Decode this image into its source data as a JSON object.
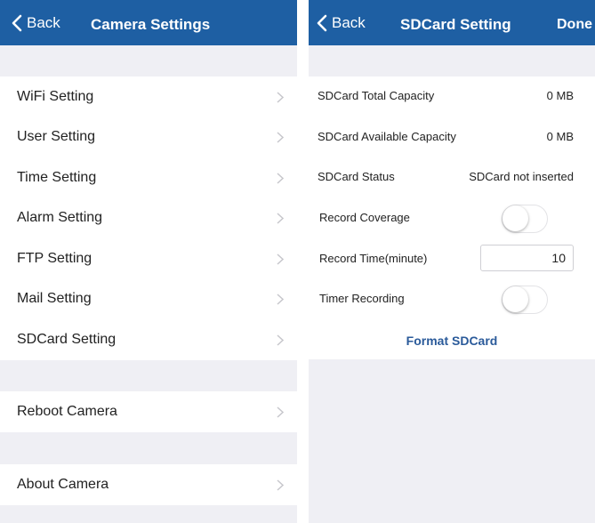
{
  "left": {
    "nav": {
      "back_label": "Back",
      "title": "Camera Settings"
    },
    "items": [
      {
        "label": "WiFi Setting"
      },
      {
        "label": "User Setting"
      },
      {
        "label": "Time Setting"
      },
      {
        "label": "Alarm Setting"
      },
      {
        "label": "FTP Setting"
      },
      {
        "label": "Mail Setting"
      },
      {
        "label": "SDCard Setting"
      }
    ],
    "reboot": {
      "label": "Reboot Camera"
    },
    "about": {
      "label": "About Camera"
    }
  },
  "right": {
    "nav": {
      "back_label": "Back",
      "title": "SDCard Setting",
      "done_label": "Done"
    },
    "total_capacity": {
      "label": "SDCard Total Capacity",
      "value": "0 MB"
    },
    "available_capacity": {
      "label": "SDCard Available Capacity",
      "value": "0 MB"
    },
    "status": {
      "label": "SDCard Status",
      "value": "SDCard not inserted"
    },
    "record_coverage": {
      "label": "Record Coverage",
      "on": false
    },
    "record_time": {
      "label": "Record Time(minute)",
      "value": "10"
    },
    "timer_recording": {
      "label": "Timer Recording",
      "on": false
    },
    "format_label": "Format SDCard"
  },
  "colors": {
    "nav_bar": "#1e5fa3",
    "background": "#efeff4",
    "link": "#2a5a9a",
    "chevron": "#c7c7cc"
  },
  "icons": {
    "back": "chevron-left-icon",
    "disclosure": "chevron-right-icon"
  }
}
